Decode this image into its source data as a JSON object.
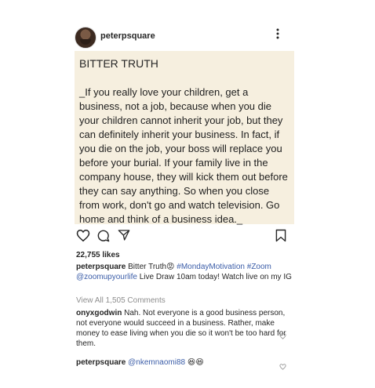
{
  "header": {
    "username": "peterpsquare"
  },
  "post": {
    "title": "BITTER TRUTH",
    "body": "_If you really love your children, get a business, not a job, because when you die your children cannot inherit your job, but they can definitely inherit your business. In fact, if you die on the job, your boss will replace you before your burial. If your family live in the company house, they will kick them out before they can say anything. So when you close from work, don't go and watch television. Go home and think of a business idea._",
    "background_color": "#f6efdf"
  },
  "actions": {
    "icons": [
      "heart-icon",
      "comment-icon",
      "share-icon",
      "bookmark-icon"
    ]
  },
  "likes": "22,755 likes",
  "caption": {
    "username": "peterpsquare",
    "text_before": " Bitter Truth",
    "emoji": "😡",
    "hashtags": " #MondayMotivation #Zoom",
    "mention": "@zoomupyourlife",
    "text_after": " Live Draw 10am today! Watch live on my IG"
  },
  "view_all": "View All 1,505 Comments",
  "comments": [
    {
      "username": "onyxgodwin",
      "text": " Nah. Not everyone is a good business person, not everyone would succeed in a business. Rather, make money to ease living when you die so it won't be too hard for them."
    },
    {
      "username": "peterpsquare",
      "mention": " @nkemnaomi88",
      "emoji": " 😆😆"
    }
  ],
  "colors": {
    "link": "#3b5da8",
    "muted": "#8e8e8e"
  }
}
